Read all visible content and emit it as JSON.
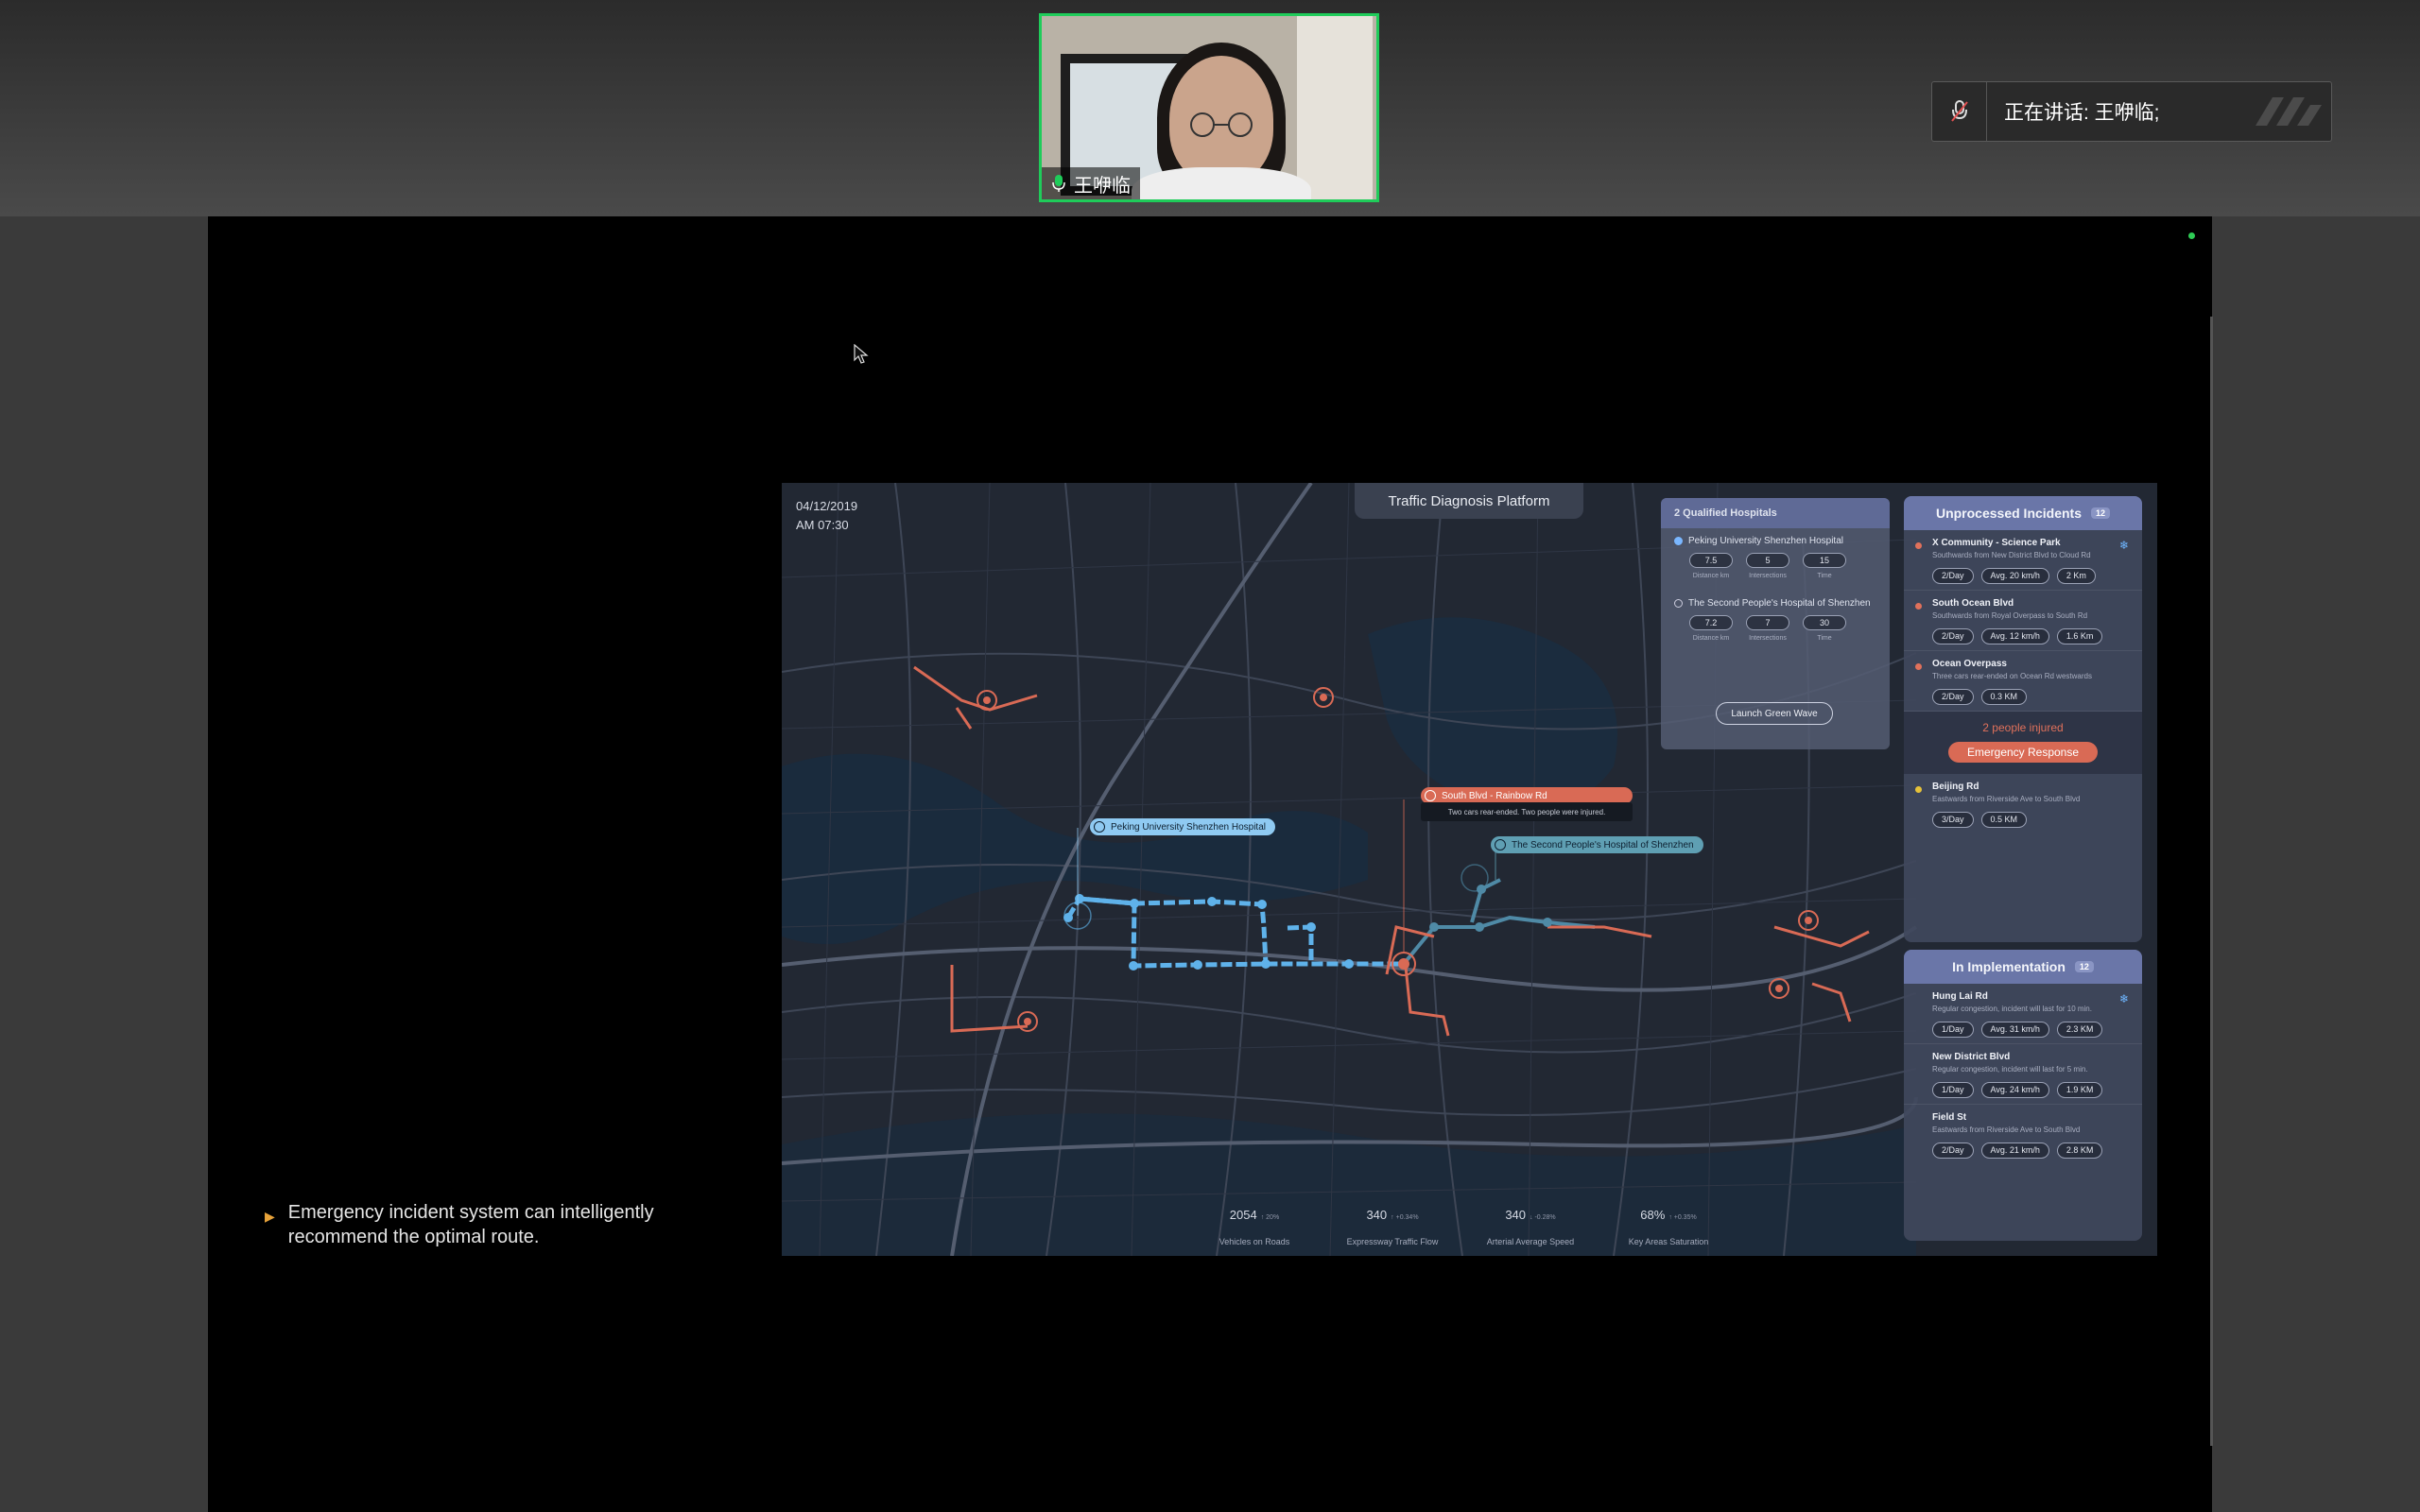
{
  "meeting": {
    "participant_name": "王咿临",
    "speaking_label": "正在讲话: 王咿临;"
  },
  "caption": {
    "text": "Emergency incident system can intelligently recommend the optimal route."
  },
  "slide": {
    "date": "04/12/2019",
    "time": "AM 07:30",
    "title": "Traffic Diagnosis Platform",
    "hospitals_panel": {
      "title": "2 Qualified Hospitals",
      "items": [
        {
          "name": "Peking University Shenzhen Hospital",
          "distance": "7.5",
          "intersections": "5",
          "time": "15",
          "selected": true
        },
        {
          "name": "The Second People's Hospital of Shenzhen",
          "distance": "7.2",
          "intersections": "7",
          "time": "30",
          "selected": false
        }
      ],
      "caption_distance": "Distance km",
      "caption_intersections": "Intersections",
      "caption_time": "Time",
      "button": "Launch Green Wave"
    },
    "map_labels": {
      "hospital_a": "Peking University Shenzhen Hospital",
      "hospital_b": "The Second People's Hospital of Shenzhen",
      "incident": "South Blvd - Rainbow Rd",
      "incident_detail": "Two cars rear-ended. Two people were injured."
    },
    "unprocessed": {
      "title": "Unprocessed Incidents",
      "count": "12",
      "items": [
        {
          "name": "X Community - Science Park",
          "desc": "Southwards from New District Blvd to Cloud Rd",
          "chips": [
            "2/Day",
            "Avg. 20 km/h",
            "2 Km"
          ],
          "color": "#e0715b"
        },
        {
          "name": "South Ocean Blvd",
          "desc": "Southwards from Royal Overpass to South Rd",
          "chips": [
            "2/Day",
            "Avg. 12 km/h",
            "1.6 Km"
          ],
          "color": "#e0715b"
        },
        {
          "name": "Ocean Overpass",
          "desc": "Three cars rear-ended on Ocean Rd westwards",
          "chips": [
            "2/Day",
            "0.3 KM"
          ],
          "color": "#e0715b"
        }
      ],
      "injured_text": "2 people injured",
      "emergency_button": "Emergency Response",
      "extra": {
        "name": "Beijing Rd",
        "desc": "Eastwards from Riverside Ave to South Blvd",
        "chips": [
          "3/Day",
          "0.5 KM"
        ],
        "color": "#e6c23a"
      }
    },
    "implementation": {
      "title": "In Implementation",
      "count": "12",
      "items": [
        {
          "name": "Hung Lai Rd",
          "desc": "Regular congestion, incident will last for 10 min.",
          "chips": [
            "1/Day",
            "Avg. 31 km/h",
            "2.3 KM"
          ]
        },
        {
          "name": "New District Blvd",
          "desc": "Regular congestion, incident will last for 5 min.",
          "chips": [
            "1/Day",
            "Avg. 24 km/h",
            "1.9 KM"
          ]
        },
        {
          "name": "Field St",
          "desc": "Eastwards from Riverside Ave to South Blvd",
          "chips": [
            "2/Day",
            "Avg. 21 km/h",
            "2.8 KM"
          ]
        }
      ]
    },
    "stats": [
      {
        "value": "2054",
        "delta": "↑ 20%",
        "label": "Vehicles on Roads"
      },
      {
        "value": "340",
        "delta": "↑ +0.34%",
        "label": "Expressway Traffic Flow"
      },
      {
        "value": "340",
        "delta": "↓ -0.28%",
        "label": "Arterial Average Speed"
      },
      {
        "value": "68%",
        "delta": "↑ +0.35%",
        "label": "Key Areas Saturation"
      }
    ]
  }
}
